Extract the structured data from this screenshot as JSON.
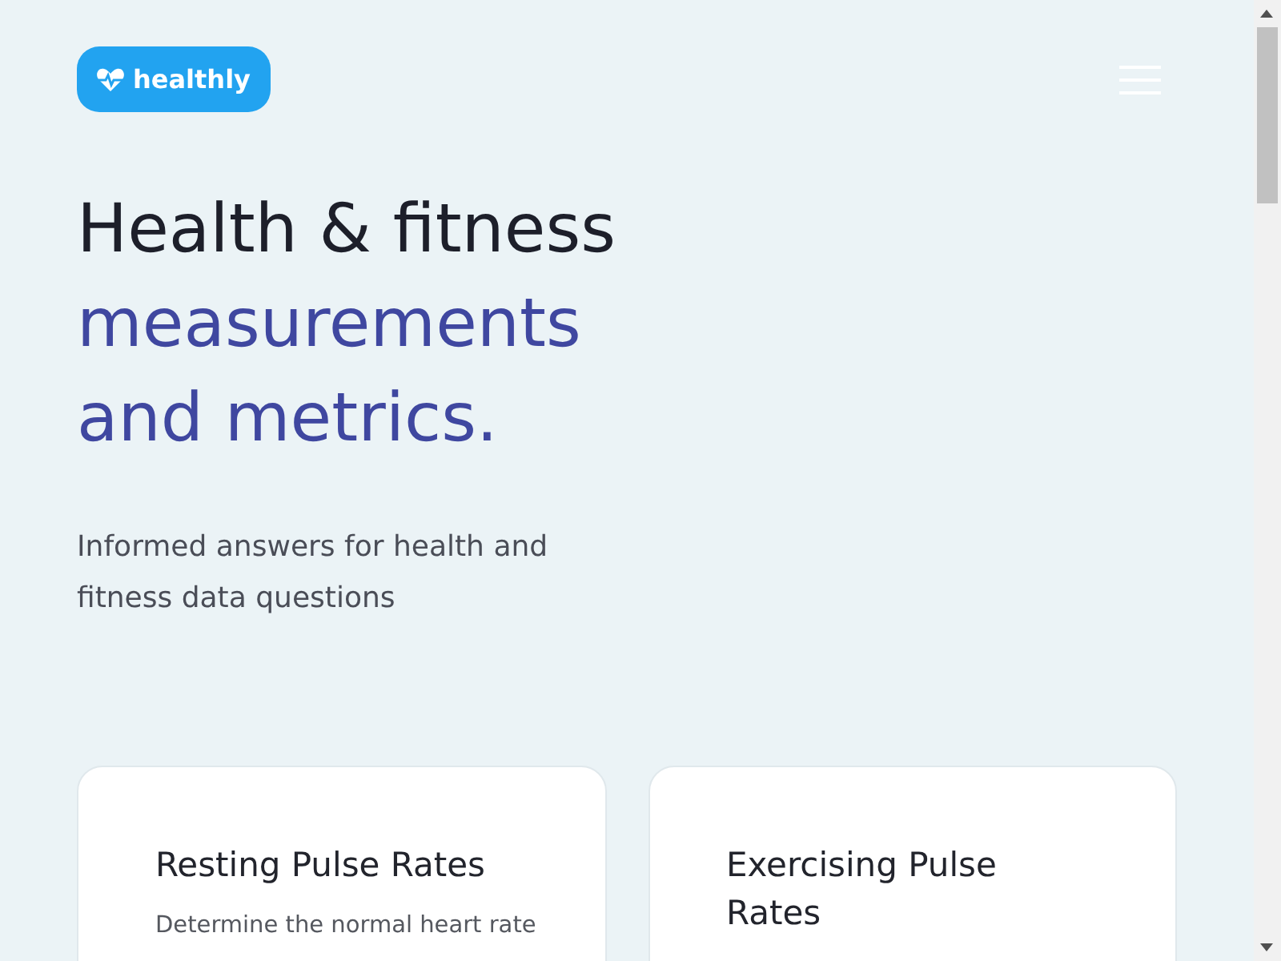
{
  "header": {
    "logo": {
      "text": "healthly"
    }
  },
  "hero": {
    "title": "Health & fitness",
    "title_accent_lines": [
      "measurements",
      "and metrics."
    ],
    "subtitle_lines": [
      "Informed answers for health and",
      "fitness data questions"
    ]
  },
  "cards": [
    {
      "title": "Resting Pulse Rates",
      "description": "Determine the normal heart rate"
    },
    {
      "title": "Exercising Pulse Rates"
    }
  ]
}
